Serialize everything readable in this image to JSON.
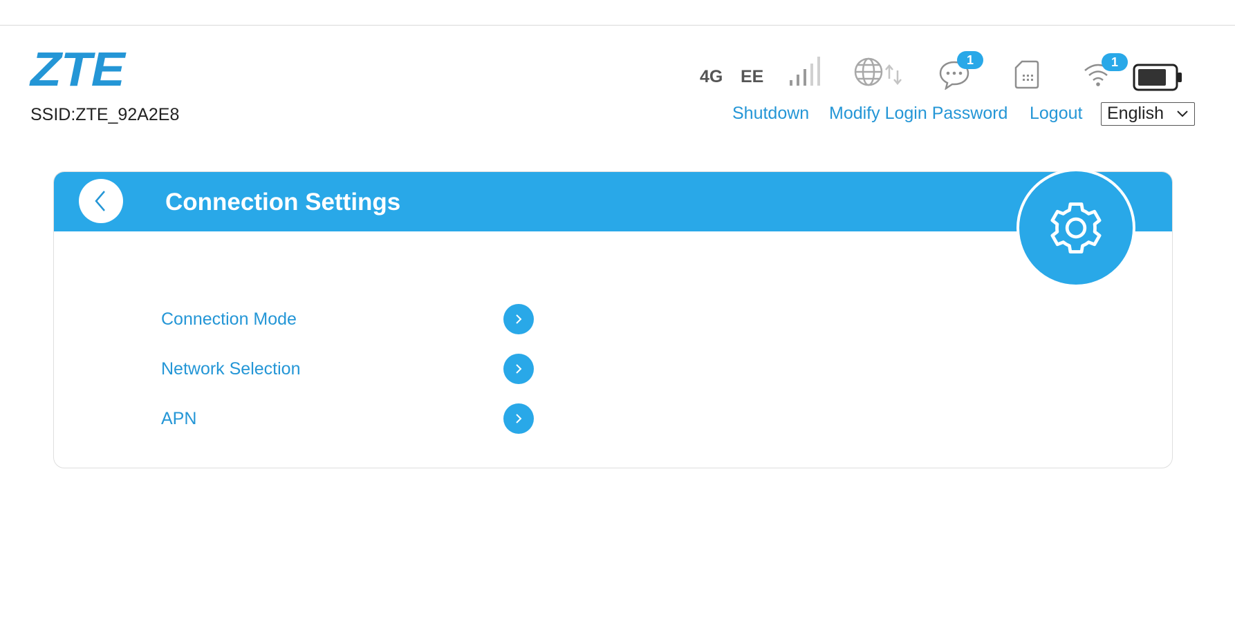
{
  "header": {
    "logo": "ZTE",
    "ssid": "SSID:ZTE_92A2E8",
    "network_type": "4G",
    "operator": "EE",
    "sms_badge": "1",
    "wifi_badge": "1",
    "icons": [
      "signal-icon",
      "globe-icon",
      "transfer-arrows-icon",
      "sms-icon",
      "sim-card-icon",
      "wifi-icon",
      "battery-icon"
    ]
  },
  "toplinks": {
    "shutdown": "Shutdown",
    "modify_password": "Modify Login Password",
    "logout": "Logout"
  },
  "language": {
    "selected": "English"
  },
  "panel": {
    "title": "Connection Settings",
    "items": [
      {
        "label": "Connection Mode"
      },
      {
        "label": "Network Selection"
      },
      {
        "label": "APN"
      }
    ]
  },
  "colors": {
    "accent": "#29a8e8",
    "link": "#2496d6"
  }
}
